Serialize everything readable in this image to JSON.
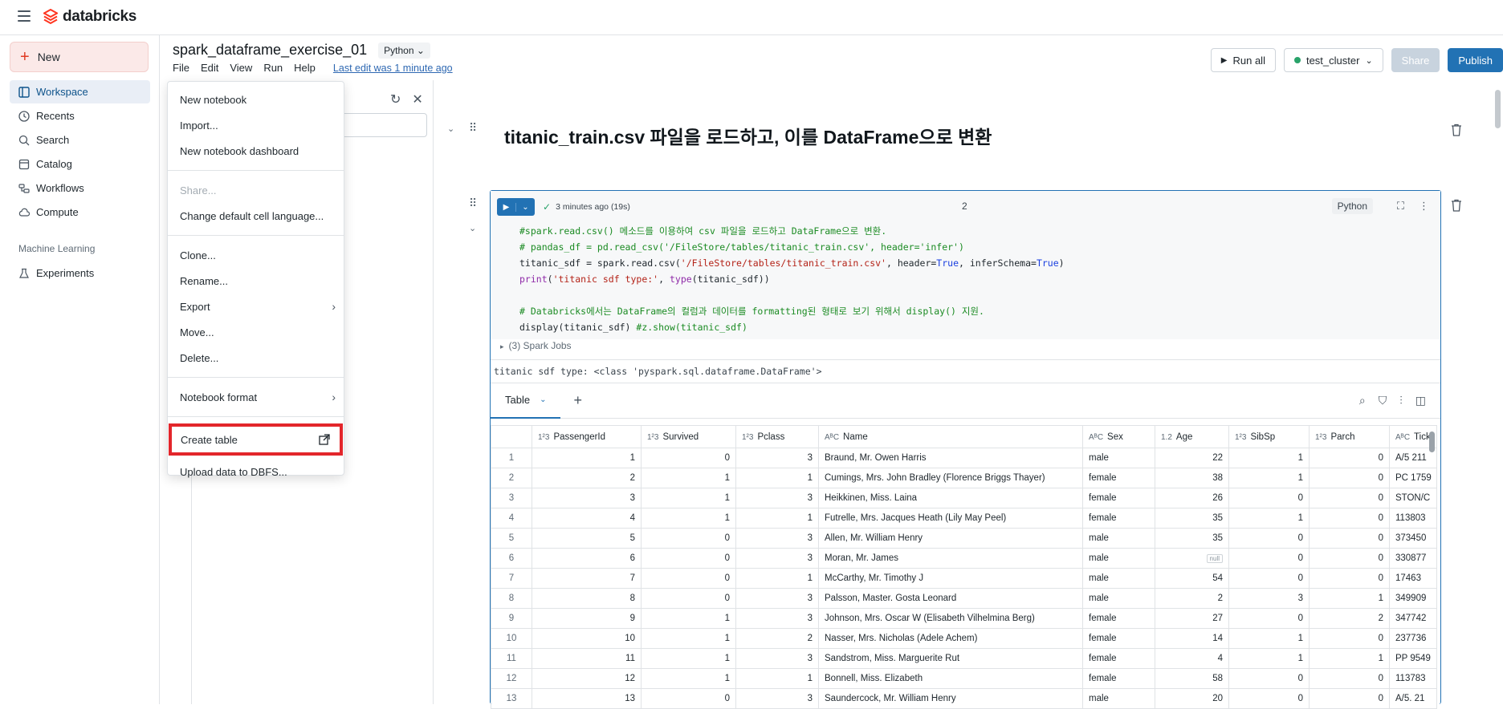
{
  "app": {
    "brand": "databricks"
  },
  "sidebar": {
    "new_label": "New",
    "items": [
      {
        "label": "Workspace",
        "icon": "workspace-icon"
      },
      {
        "label": "Recents",
        "icon": "clock-icon"
      },
      {
        "label": "Search",
        "icon": "search-icon"
      },
      {
        "label": "Catalog",
        "icon": "catalog-icon"
      },
      {
        "label": "Workflows",
        "icon": "workflows-icon"
      },
      {
        "label": "Compute",
        "icon": "cloud-icon"
      }
    ],
    "section_label": "Machine Learning",
    "ml_items": [
      {
        "label": "Experiments",
        "icon": "flask-icon"
      }
    ]
  },
  "notebook": {
    "title": "spark_dataframe_exercise_01",
    "language": "Python",
    "menus": [
      "File",
      "Edit",
      "View",
      "Run",
      "Help"
    ],
    "last_edit": "Last edit was 1 minute ago"
  },
  "actions": {
    "run_all": "Run all",
    "cluster": "test_cluster",
    "share": "Share",
    "publish": "Publish"
  },
  "file_menu": {
    "items": [
      "New notebook",
      "Import...",
      "New notebook dashboard",
      "Share...",
      "Change default cell language...",
      "Clone...",
      "Rename...",
      "Export",
      "Move...",
      "Delete...",
      "Notebook format",
      "Create table",
      "Upload data to DBFS..."
    ]
  },
  "markdown_cell": {
    "title": "titanic_train.csv 파일을 로드하고, 이를 DataFrame으로 변환"
  },
  "code_cell": {
    "status": "3 minutes ago (19s)",
    "number": "2",
    "language": "Python",
    "spark_jobs": "(3) Spark Jobs",
    "stdout": "titanic sdf type: <class 'pyspark.sql.dataframe.DataFrame'>"
  },
  "results": {
    "tab_label": "Table",
    "columns": [
      {
        "name": "PassengerId",
        "type": "1²3"
      },
      {
        "name": "Survived",
        "type": "1²3"
      },
      {
        "name": "Pclass",
        "type": "1²3"
      },
      {
        "name": "Name",
        "type": "AᴮC"
      },
      {
        "name": "Sex",
        "type": "AᴮC"
      },
      {
        "name": "Age",
        "type": "1.2"
      },
      {
        "name": "SibSp",
        "type": "1²3"
      },
      {
        "name": "Parch",
        "type": "1²3"
      },
      {
        "name": "Tick",
        "type": "AᴮC"
      }
    ],
    "rows": [
      [
        "1",
        "1",
        "0",
        "3",
        "Braund, Mr. Owen Harris",
        "male",
        "22",
        "1",
        "0",
        "A/5 211"
      ],
      [
        "2",
        "2",
        "1",
        "1",
        "Cumings, Mrs. John Bradley (Florence Briggs Thayer)",
        "female",
        "38",
        "1",
        "0",
        "PC 1759"
      ],
      [
        "3",
        "3",
        "1",
        "3",
        "Heikkinen, Miss. Laina",
        "female",
        "26",
        "0",
        "0",
        "STON/C"
      ],
      [
        "4",
        "4",
        "1",
        "1",
        "Futrelle, Mrs. Jacques Heath (Lily May Peel)",
        "female",
        "35",
        "1",
        "0",
        "113803"
      ],
      [
        "5",
        "5",
        "0",
        "3",
        "Allen, Mr. William Henry",
        "male",
        "35",
        "0",
        "0",
        "373450"
      ],
      [
        "6",
        "6",
        "0",
        "3",
        "Moran, Mr. James",
        "male",
        "null",
        "0",
        "0",
        "330877"
      ],
      [
        "7",
        "7",
        "0",
        "1",
        "McCarthy, Mr. Timothy J",
        "male",
        "54",
        "0",
        "0",
        "17463"
      ],
      [
        "8",
        "8",
        "0",
        "3",
        "Palsson, Master. Gosta Leonard",
        "male",
        "2",
        "3",
        "1",
        "349909"
      ],
      [
        "9",
        "9",
        "1",
        "3",
        "Johnson, Mrs. Oscar W (Elisabeth Vilhelmina Berg)",
        "female",
        "27",
        "0",
        "2",
        "347742"
      ],
      [
        "10",
        "10",
        "1",
        "2",
        "Nasser, Mrs. Nicholas (Adele Achem)",
        "female",
        "14",
        "1",
        "0",
        "237736"
      ],
      [
        "11",
        "11",
        "1",
        "3",
        "Sandstrom, Miss. Marguerite Rut",
        "female",
        "4",
        "1",
        "1",
        "PP 9549"
      ],
      [
        "12",
        "12",
        "1",
        "1",
        "Bonnell, Miss. Elizabeth",
        "female",
        "58",
        "0",
        "0",
        "113783"
      ],
      [
        "13",
        "13",
        "0",
        "3",
        "Saundercock, Mr. William Henry",
        "male",
        "20",
        "0",
        "0",
        "A/5. 21"
      ]
    ]
  },
  "colors": {
    "accent": "#2272b4",
    "brand": "#ff3621",
    "highlight": "#e3262b"
  }
}
